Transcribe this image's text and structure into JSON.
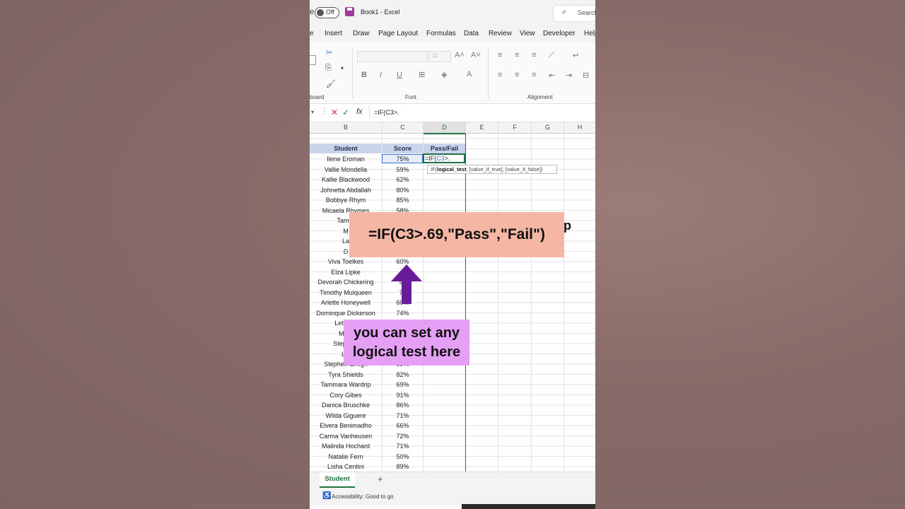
{
  "window": {
    "autosave_label": "Off",
    "title": "Book1  -  Excel",
    "search_placeholder": "Search",
    "first_tab_fragment": "e"
  },
  "tabs": [
    "Insert",
    "Draw",
    "Page Layout",
    "Formulas",
    "Data",
    "Review",
    "View",
    "Developer",
    "Help"
  ],
  "ribbon": {
    "clipboard_label": "board",
    "font_label": "Font",
    "alignment_label": "Alignment",
    "font_size": "11"
  },
  "formula_bar": {
    "content": "=IF(C3>."
  },
  "columns": [
    "B",
    "C",
    "D",
    "E",
    "F",
    "G",
    "H"
  ],
  "table": {
    "headers": [
      "Student",
      "Score",
      "Pass/Fail"
    ],
    "rows": [
      [
        "Ilene Eroman",
        "75%"
      ],
      [
        "Vallie Mondella",
        "59%"
      ],
      [
        "Kallie Blackwood",
        "62%"
      ],
      [
        "Johnetta Abdallah",
        "80%"
      ],
      [
        "Bobbye Rhym",
        "85%"
      ],
      [
        "Micaela Rhymes",
        "58%"
      ],
      [
        "Tamar",
        ""
      ],
      [
        "M",
        ""
      ],
      [
        "La",
        ""
      ],
      [
        "D",
        ""
      ],
      [
        "Viva Toelkes",
        "60%"
      ],
      [
        "Elza Lipke",
        ""
      ],
      [
        "Devorah Chickering",
        "98"
      ],
      [
        "Timothy Mulqueen",
        "70"
      ],
      [
        "Arlette Honeywell",
        "60%"
      ],
      [
        "Dominque Dickerson",
        "74%"
      ],
      [
        "Lettie Is",
        ""
      ],
      [
        "Myra",
        ""
      ],
      [
        "Stephain",
        ""
      ],
      [
        "Lai",
        ""
      ],
      [
        "Stephen Emigh",
        "55%"
      ],
      [
        "Tyra Shields",
        "82%"
      ],
      [
        "Tammara Wardrip",
        "69%"
      ],
      [
        "Cory Gibes",
        "91%"
      ],
      [
        "Danica Bruschke",
        "86%"
      ],
      [
        "Wilda Giguere",
        "71%"
      ],
      [
        "Elvera Benimadho",
        "66%"
      ],
      [
        "Carma Vanheusen",
        "72%"
      ],
      [
        "Malinda Hochard",
        "71%"
      ],
      [
        "Natalie Fern",
        "50%"
      ],
      [
        "Lisha Centini",
        "89%"
      ]
    ]
  },
  "active_cell_text": {
    "prefix": "=IF(",
    "ref": "C3",
    "suffix": ">."
  },
  "tooltip": {
    "fn": "IF(",
    "arg1": "logical_test",
    "rest": ", [value_if_true], [value_if_false])"
  },
  "overlay": {
    "formula": "=IF(C3>.69,\"Pass\",\"Fail\")",
    "callout_line1": "you can set any",
    "callout_line2": "logical test here"
  },
  "sheet": {
    "tab": "Student",
    "add": "+"
  },
  "status": {
    "accessibility": "Accessibility: Good to go"
  },
  "colors": {
    "excel_green": "#217346",
    "header_fill": "#c9d4ea",
    "banner": "#f6b6a4",
    "callout": "#e5a0f5",
    "arrow": "#6a1b9a"
  }
}
